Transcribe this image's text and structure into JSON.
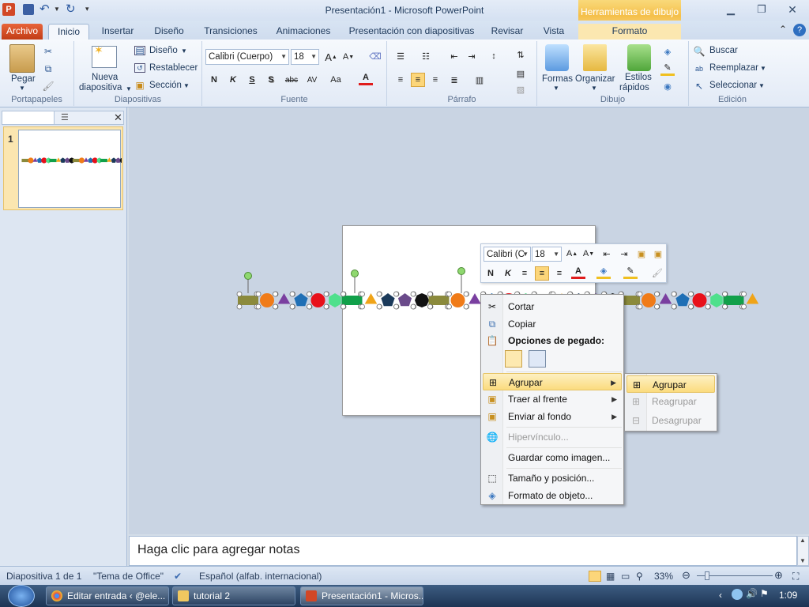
{
  "window": {
    "title": "Presentación1 - Microsoft PowerPoint",
    "context_tools": "Herramientas de dibujo"
  },
  "tabs": [
    "Archivo",
    "Inicio",
    "Insertar",
    "Diseño",
    "Transiciones",
    "Animaciones",
    "Presentación con diapositivas",
    "Revisar",
    "Vista",
    "Formato"
  ],
  "ribbon": {
    "portapapeles": {
      "label": "Portapapeles",
      "paste": "Pegar"
    },
    "diapositivas": {
      "label": "Diapositivas",
      "new1": "Nueva",
      "new2": "diapositiva",
      "design": "Diseño",
      "reset": "Restablecer",
      "section": "Sección"
    },
    "fuente": {
      "label": "Fuente",
      "font": "Calibri (Cuerpo)",
      "size": "18",
      "bold": "N",
      "italic": "K",
      "underline": "S",
      "shadow": "S",
      "strike": "abc",
      "spacing": "AV",
      "case": "Aa",
      "color": "A"
    },
    "parrafo": {
      "label": "Párrafo"
    },
    "dibujo": {
      "label": "Dibujo",
      "shapes": "Formas",
      "arrange": "Organizar",
      "styles1": "Estilos",
      "styles2": "rápidos"
    },
    "edicion": {
      "label": "Edición",
      "find": "Buscar",
      "replace": "Reemplazar",
      "select": "Seleccionar"
    }
  },
  "slides_panel": {
    "slide_number": "1"
  },
  "mini_toolbar": {
    "font": "Calibri (C",
    "size": "18",
    "bold": "N",
    "italic": "K"
  },
  "context_menu": {
    "cut": "Cortar",
    "copy": "Copiar",
    "paste_options": "Opciones de pegado:",
    "group": "Agrupar",
    "bring_front": "Traer al frente",
    "send_back": "Enviar al fondo",
    "hyperlink": "Hipervínculo...",
    "save_image": "Guardar como imagen...",
    "size_position": "Tamaño y posición...",
    "format_object": "Formato de objeto..."
  },
  "submenu": {
    "group": "Agrupar",
    "regroup": "Reagrupar",
    "ungroup": "Desagrupar"
  },
  "notes": {
    "placeholder": "Haga clic para agregar notas"
  },
  "status": {
    "slide": "Diapositiva 1 de 1",
    "theme": "\"Tema de Office\"",
    "language": "Español (alfab. internacional)",
    "zoom": "33%"
  },
  "taskbar": {
    "items": [
      "Editar entrada ‹ @ele...",
      "tutorial 2",
      "Presentación1 - Micros..."
    ],
    "clock": "1:09"
  },
  "colors": {
    "accent": "#fbdc7e",
    "archivo": "#d24726",
    "ribbon": "#e2eaf6"
  },
  "shapes": {
    "colors": [
      "#8b8a3c",
      "#f07b18",
      "#7a3fa0",
      "#1f6fb5",
      "#e8101a",
      "#4fe08c",
      "#11a04a",
      "#f0a418",
      "#1b3a5a",
      "#6a4a8a",
      "#111111"
    ]
  }
}
